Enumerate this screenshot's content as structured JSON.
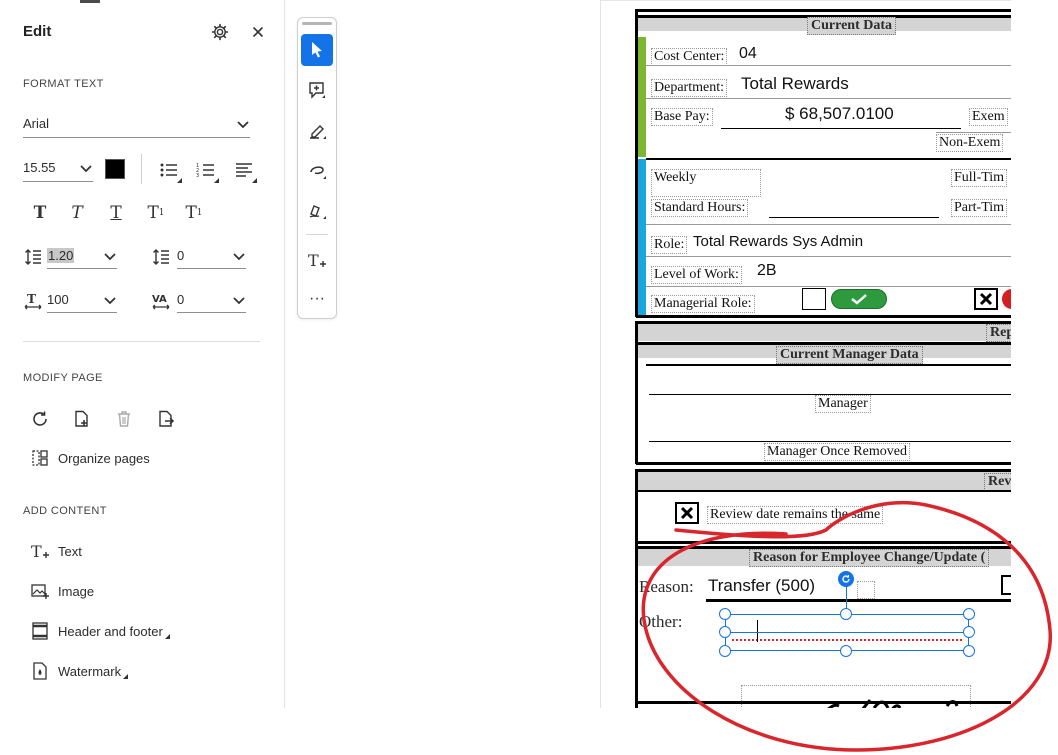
{
  "panel": {
    "title": "Edit",
    "format_text_label": "FORMAT TEXT",
    "font_family": "Arial",
    "font_size": "15.55",
    "text_color": "#000000",
    "line_spacing": "1.20",
    "paragraph_spacing": "0",
    "horizontal_scale": "100",
    "char_spacing": "0",
    "modify_page_label": "MODIFY PAGE",
    "organize_pages": "Organize pages",
    "add_content_label": "ADD CONTENT",
    "add_items": [
      "Text",
      "Image",
      "Header and footer",
      "Watermark"
    ]
  },
  "document": {
    "current_data_header": "Current Data",
    "cost_center_label": "Cost Center:",
    "cost_center_value": "04",
    "department_label": "Department:",
    "department_value": "Total Rewards",
    "base_pay_label": "Base Pay:",
    "base_pay_value": "$ 68,507.0100",
    "exempt_label": "Exem",
    "non_exempt_label": "Non-Exem",
    "weekly_label": "Weekly",
    "full_time_label": "Full-Tim",
    "standard_hours_label": "Standard Hours:",
    "part_time_label": "Part-Tim",
    "role_label": "Role:",
    "role_value": "Total Rewards Sys Admin",
    "level_label": "Level of Work:",
    "level_value": "2B",
    "managerial_label": "Managerial Role:",
    "rep_header": "Rep",
    "current_manager_header": "Current Manager Data",
    "manager_label": "Manager",
    "manager_once_removed_label": "Manager Once Removed",
    "rev_header": "Rev",
    "review_date_label": "Review date remains the same",
    "reason_header": "Reason for Employee Change/Update (",
    "reason_label": "Reason:",
    "reason_value": "Transfer (500)",
    "other_label": "Other:"
  },
  "colors": {
    "accent": "#1473e6",
    "green_bar": "#7cb82f",
    "blue_bar": "#1aa7e0",
    "annotation_red": "#d9262c"
  }
}
